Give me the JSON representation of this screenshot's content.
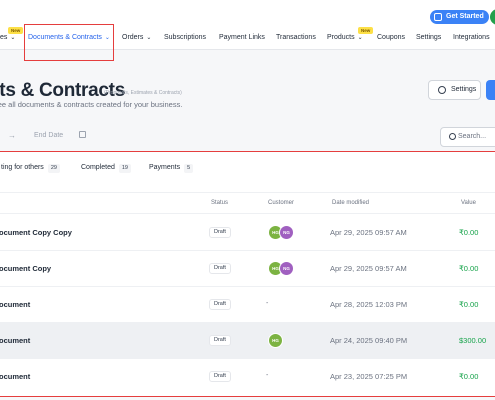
{
  "top": {
    "get_started_label": "Get Started"
  },
  "nav": {
    "items": [
      {
        "label": "es",
        "has_chevron": true,
        "badge": "New"
      },
      {
        "label": "Documents & Contracts",
        "has_chevron": true,
        "active": true
      },
      {
        "label": "Orders",
        "has_chevron": true
      },
      {
        "label": "Subscriptions"
      },
      {
        "label": "Payment Links"
      },
      {
        "label": "Transactions"
      },
      {
        "label": "Products",
        "has_chevron": true,
        "badge": "New"
      },
      {
        "label": "Coupons"
      },
      {
        "label": "Settings"
      },
      {
        "label": "Integrations"
      }
    ]
  },
  "header": {
    "title": "nts & Contracts",
    "title_suffix": "(Proposals, Estimates & Contracts)",
    "description": "see all documents & contracts created for your business.",
    "settings_label": "Settings"
  },
  "filters": {
    "arrow": "→",
    "end_date_placeholder": "End Date",
    "search_placeholder": "Search..."
  },
  "tabs": [
    {
      "label": "ting for others",
      "count": "29"
    },
    {
      "label": "Completed",
      "count": "19"
    },
    {
      "label": "Payments",
      "count": "5"
    }
  ],
  "table": {
    "columns": {
      "status": "Status",
      "customer": "Customer",
      "date_modified": "Date modified",
      "value": "Value"
    },
    "rows": [
      {
        "name": "ocument Copy Copy",
        "status": "Draft",
        "customers": [
          "HG",
          "NG"
        ],
        "date": "Apr 29, 2025 09:57 AM",
        "value": "₹0.00"
      },
      {
        "name": "ocument Copy",
        "status": "Draft",
        "customers": [
          "HG",
          "NG"
        ],
        "date": "Apr 29, 2025 09:57 AM",
        "value": "₹0.00"
      },
      {
        "name": "ocument",
        "status": "Draft",
        "customers_placeholder": "-",
        "date": "Apr 28, 2025 12:03 PM",
        "value": "₹0.00"
      },
      {
        "name": "ocument",
        "status": "Draft",
        "customers": [
          "HG"
        ],
        "date": "Apr 24, 2025 09:40 PM",
        "value": "$300.00"
      },
      {
        "name": "ocument",
        "status": "Draft",
        "customers_placeholder": "-",
        "date": "Apr 23, 2025 07:25 PM",
        "value": "₹0.00"
      }
    ]
  },
  "colors": {
    "accent": "#2563eb",
    "button_blue": "#3b82f6",
    "highlight_red": "#e53e3e",
    "value_green": "#16a34a",
    "avatar_hg": "#7cb342",
    "avatar_ng": "#a060c0"
  },
  "icons": {
    "settings": "gear-icon",
    "search": "search-icon",
    "calendar": "calendar-icon",
    "get_started": "card-icon"
  }
}
